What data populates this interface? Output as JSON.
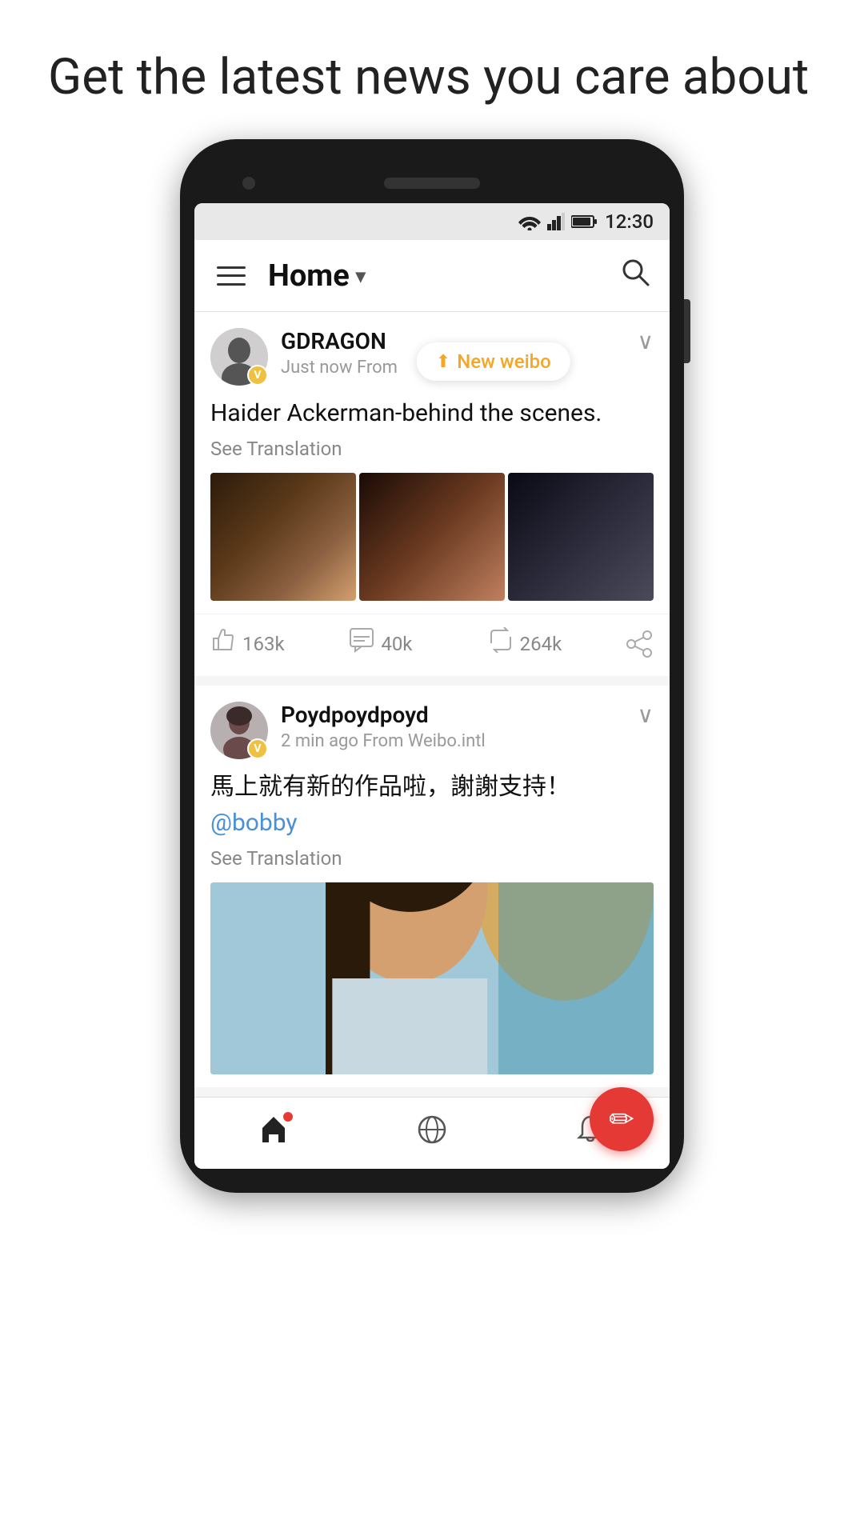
{
  "page": {
    "headline": "Get the latest news you care about"
  },
  "statusBar": {
    "time": "12:30"
  },
  "navBar": {
    "title": "Home",
    "dropdownArrow": "▾"
  },
  "newWeiboBadge": {
    "text": "New weibo"
  },
  "posts": [
    {
      "id": "post-1",
      "username": "GDRAGON",
      "timeAgo": "Just now",
      "source": "From",
      "text": "Haider Ackerman-behind the scenes.",
      "seeTranslation": "See Translation",
      "likes": "163k",
      "comments": "40k",
      "reposts": "264k",
      "vipLabel": "V"
    },
    {
      "id": "post-2",
      "username": "Poydpoydpoyd",
      "timeAgo": "2 min ago",
      "source": "From Weibo.intl",
      "text": "馬上就有新的作品啦，謝謝支持！",
      "mention": "@bobby",
      "seeTranslation": "See Translation",
      "vipLabel": "V"
    }
  ],
  "bottomNav": {
    "home": "⌂",
    "discover": "⊚",
    "notifications": "🔔"
  }
}
